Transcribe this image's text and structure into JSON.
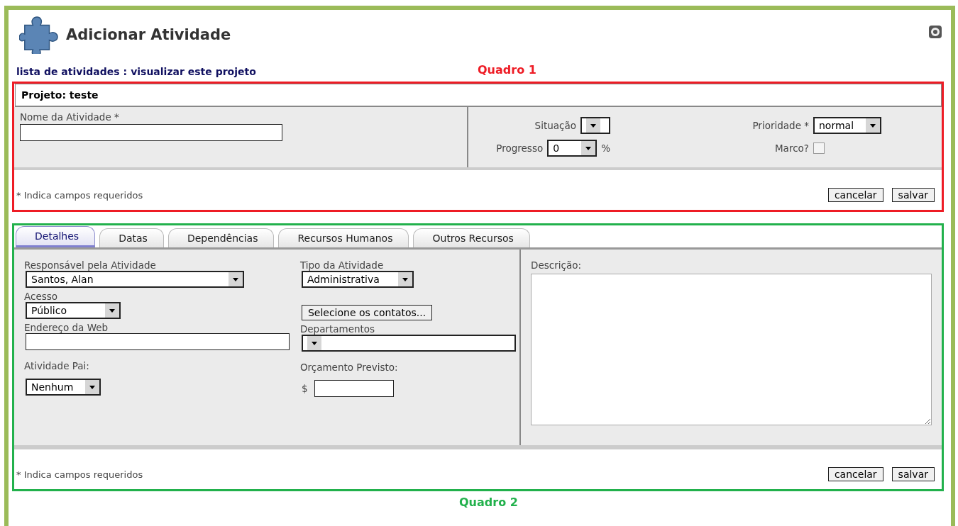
{
  "header": {
    "title": "Adicionar Atividade"
  },
  "breadcrumb": {
    "links": [
      "lista de atividades",
      "visualizar este projeto"
    ],
    "separator": ":"
  },
  "annotations": [
    {
      "label": "Quadro 1",
      "color": "#ee1c25"
    },
    {
      "label": "Quadro 2",
      "color": "#22b14c"
    }
  ],
  "project": {
    "label": "Projeto: teste"
  },
  "main_form": {
    "left": [
      {
        "kind": "text",
        "label": "Nome da Atividade *"
      }
    ],
    "right": [
      {
        "kind": "select",
        "label": "Situação"
      },
      {
        "kind": "select",
        "label": "Prioridade *",
        "value": "normal"
      },
      {
        "kind": "select",
        "label": "Progresso",
        "value": "0",
        "suffix": "%"
      },
      {
        "kind": "checkbox",
        "label": "Marco?",
        "checked": false
      }
    ]
  },
  "footers": [
    {
      "note": "* Indica campos requeridos",
      "buttons": [
        "cancelar",
        "salvar"
      ]
    },
    {
      "note": "* Indica campos requeridos",
      "buttons": [
        "cancelar",
        "salvar"
      ]
    }
  ],
  "tabs": [
    {
      "label": "Detalhes",
      "selected": true
    },
    {
      "label": "Datas",
      "selected": false
    },
    {
      "label": "Dependências",
      "selected": false
    },
    {
      "label": "Recursos Humanos",
      "selected": false
    },
    {
      "label": "Outros Recursos",
      "selected": false
    }
  ],
  "details": {
    "columns": [
      [
        {
          "kind": "select",
          "label": "Responsável pela Atividade",
          "value": "Santos, Alan"
        },
        {
          "kind": "select",
          "label": "Acesso",
          "value": "Público"
        },
        {
          "kind": "text",
          "label": "Endereço da Web"
        },
        {
          "kind": "select",
          "label": "Atividade Pai:",
          "value": "Nenhum"
        }
      ],
      [
        {
          "kind": "select",
          "label": "Tipo da Atividade",
          "value": "Administrativa"
        },
        {
          "kind": "button",
          "value": "Selecione os contatos..."
        },
        {
          "kind": "select",
          "label": "Departamentos"
        },
        {
          "kind": "text",
          "label": "Orçamento Previsto:",
          "prefix": "$"
        }
      ]
    ],
    "description": {
      "label": "Descrição:"
    }
  }
}
